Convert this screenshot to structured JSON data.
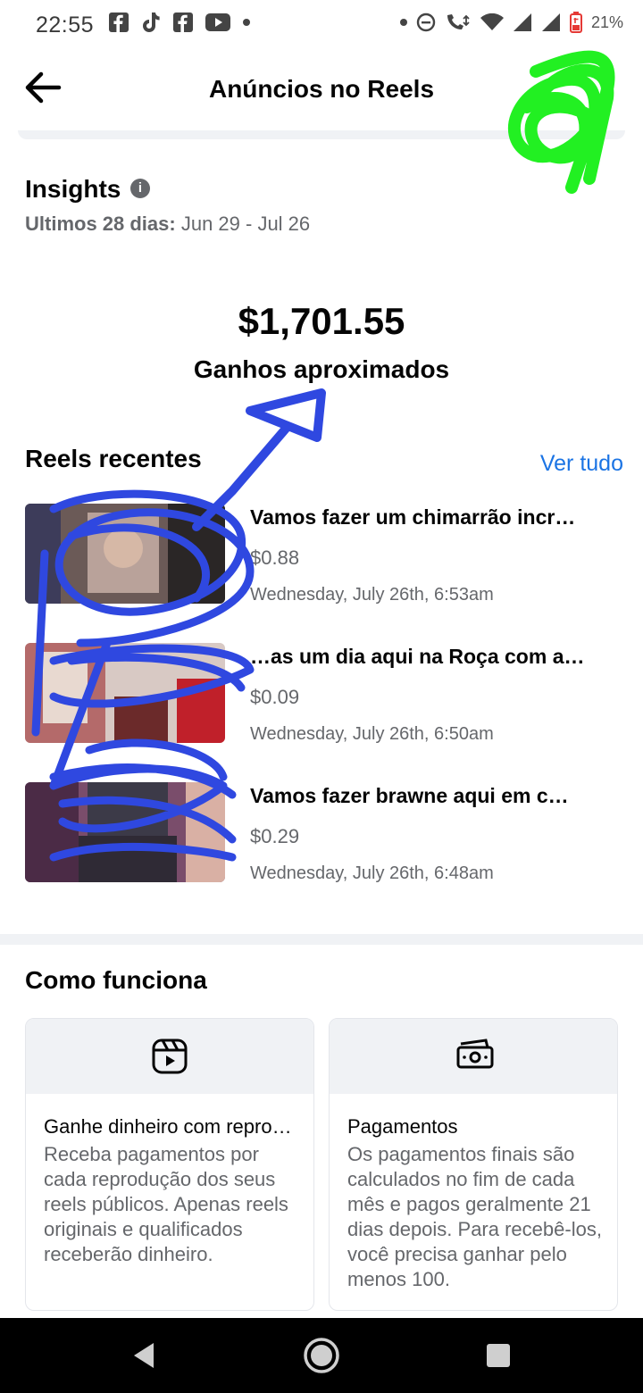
{
  "status_bar": {
    "time": "22:55",
    "battery_percent": "21%"
  },
  "header": {
    "title": "Anúncios no Reels",
    "back_icon": "arrow-left-icon"
  },
  "insights": {
    "title": "Insights",
    "period_label": "Ultimos 28 dias:",
    "period_range": "Jun 29 - Jul 26",
    "earnings_value": "$1,701.55",
    "earnings_label": "Ganhos aproximados"
  },
  "recent_reels": {
    "title": "Reels recentes",
    "see_all_label": "Ver tudo",
    "items": [
      {
        "title": "Vamos fazer um chimarrão incr…",
        "amount": "$0.88",
        "date": "Wednesday, July 26th, 6:53am"
      },
      {
        "title": "…as um dia aqui na Roça com a…",
        "amount": "$0.09",
        "date": "Wednesday, July 26th, 6:50am"
      },
      {
        "title": "Vamos fazer brawne aqui em c…",
        "amount": "$0.29",
        "date": "Wednesday, July 26th, 6:48am"
      }
    ]
  },
  "how_it_works": {
    "title": "Como funciona",
    "cards": [
      {
        "icon": "reels-icon",
        "title": "Ganhe dinheiro com repro…",
        "body": "Receba pagamentos por cada reprodução dos seus reels públicos. Apenas reels originais e qualificados receberão dinheiro."
      },
      {
        "icon": "money-icon",
        "title": "Pagamentos",
        "body": "Os pagamentos finais são calculados no fim de cada mês e pagos geralmente 21 dias depois. Para recebê-los, você precisa ganhar pelo menos 100."
      }
    ]
  },
  "colors": {
    "link": "#1b74e4",
    "scribble_blue": "#2f48e0",
    "scribble_green": "#22f022"
  }
}
